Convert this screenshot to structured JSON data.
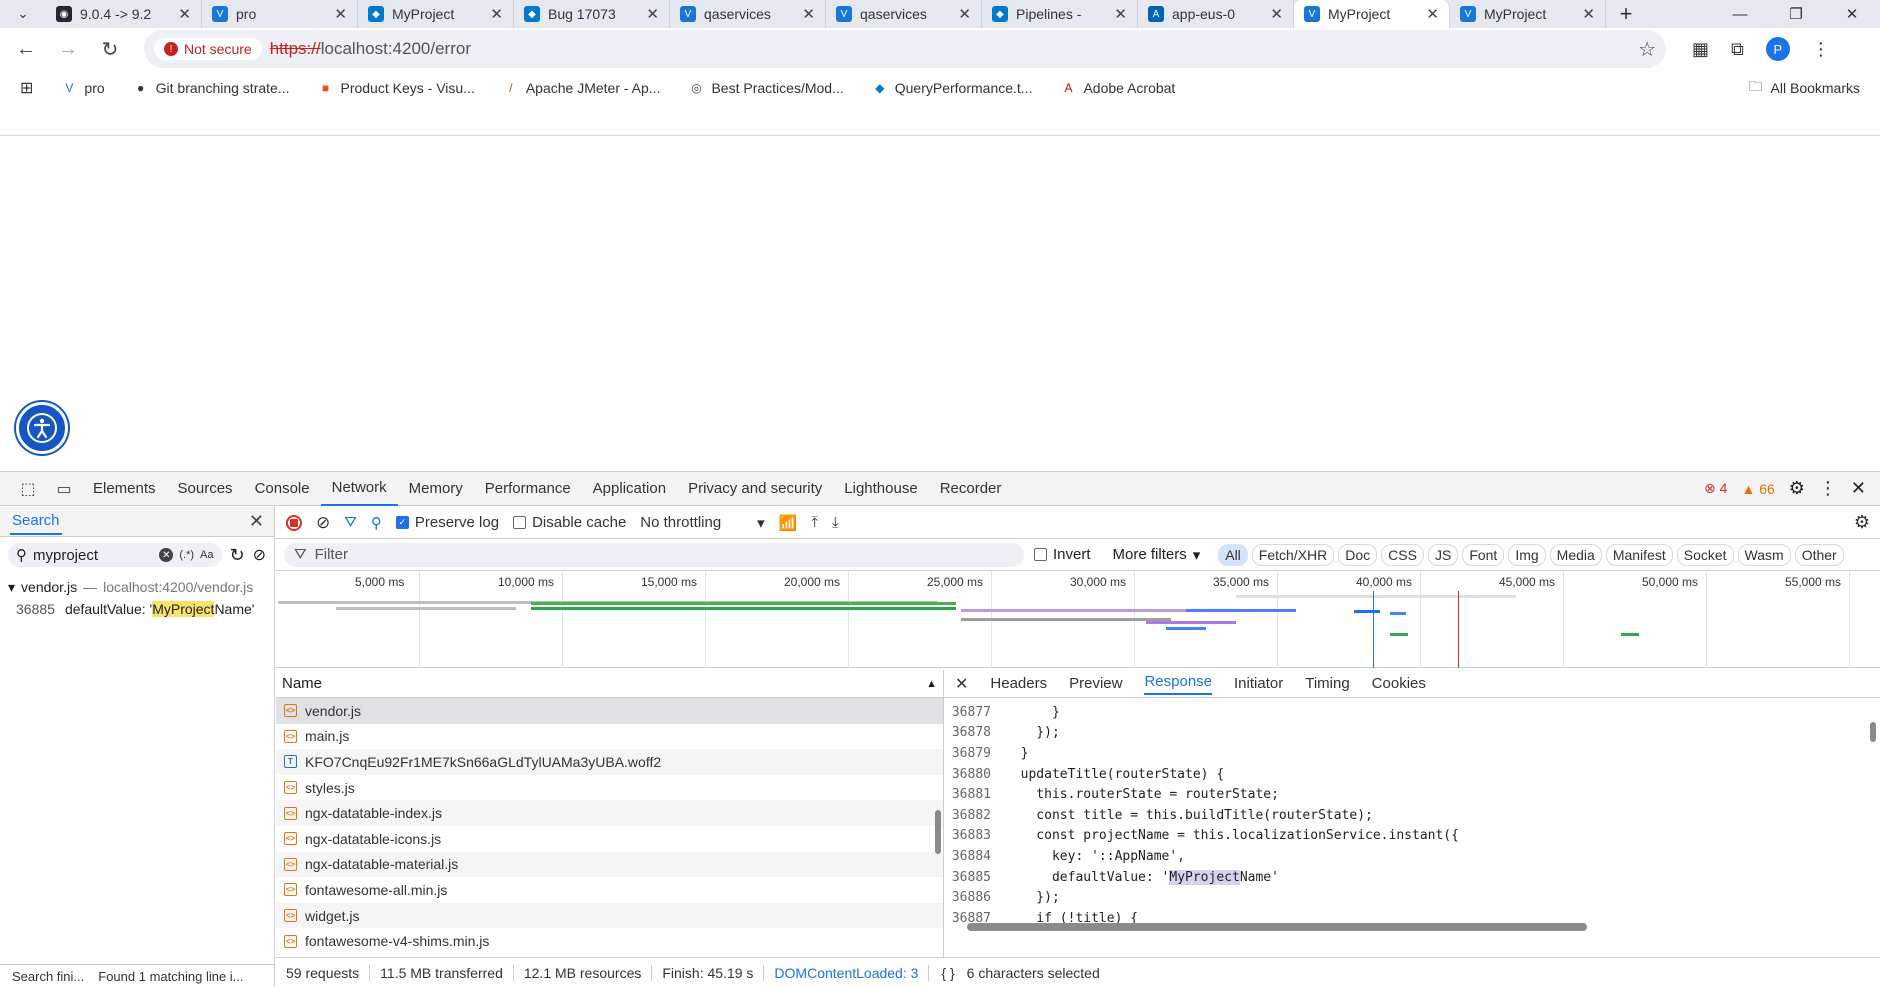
{
  "browser": {
    "tabs": [
      {
        "label": "9.0.4 -> 9.2",
        "icon": "github-icon",
        "active": false
      },
      {
        "label": "pro",
        "icon": "vo-icon",
        "active": false
      },
      {
        "label": "MyProject",
        "icon": "azure-devops-icon",
        "active": false
      },
      {
        "label": "Bug 17073",
        "icon": "azure-devops-icon",
        "active": false
      },
      {
        "label": "qaservices",
        "icon": "vo-icon",
        "active": false
      },
      {
        "label": "qaservices",
        "icon": "vo-icon",
        "active": false
      },
      {
        "label": "Pipelines -",
        "icon": "azure-devops-icon",
        "active": false
      },
      {
        "label": "app-eus-0",
        "icon": "azure-icon",
        "active": false
      },
      {
        "label": "MyProject",
        "icon": "vo-icon",
        "active": true
      },
      {
        "label": "MyProject",
        "icon": "vo-icon",
        "active": false
      }
    ],
    "security_label": "Not secure",
    "url_scheme": "https://",
    "url_rest": "localhost:4200/error",
    "profile_initial": "P",
    "bookmarks": [
      {
        "label": "pro",
        "icon": "vo-icon"
      },
      {
        "label": "Git branching strate...",
        "icon": "globe-icon"
      },
      {
        "label": "Product Keys - Visu...",
        "icon": "microsoft-icon"
      },
      {
        "label": "Apache JMeter - Ap...",
        "icon": "feather-icon"
      },
      {
        "label": "Best Practices/Mod...",
        "icon": "spiral-icon"
      },
      {
        "label": "QueryPerformance.t...",
        "icon": "azure-devops-icon"
      },
      {
        "label": "Adobe Acrobat",
        "icon": "acrobat-icon"
      }
    ],
    "all_bookmarks": "All Bookmarks"
  },
  "devtools": {
    "tabs": [
      "Elements",
      "Sources",
      "Console",
      "Network",
      "Memory",
      "Performance",
      "Application",
      "Privacy and security",
      "Lighthouse",
      "Recorder"
    ],
    "active_tab": "Network",
    "error_count": "4",
    "warning_count": "66",
    "search": {
      "title": "Search",
      "query": "myproject",
      "regex_label": "(.*)",
      "case_label": "Aa",
      "result_file": "vendor.js",
      "result_path": "localhost:4200/vendor.js",
      "result_line_no": "36885",
      "result_before": "defaultValue: '",
      "result_match": "MyProject",
      "result_after": "Name'",
      "status_left": "Search fini...",
      "status_right": "Found 1 matching line i..."
    },
    "network": {
      "preserve_log": "Preserve log",
      "disable_cache": "Disable cache",
      "throttling": "No throttling",
      "filter_placeholder": "Filter",
      "invert": "Invert",
      "more_filters": "More filters",
      "type_filters": [
        "All",
        "Fetch/XHR",
        "Doc",
        "CSS",
        "JS",
        "Font",
        "Img",
        "Media",
        "Manifest",
        "Socket",
        "Wasm",
        "Other"
      ],
      "timeline_ticks": [
        "5,000 ms",
        "10,000 ms",
        "15,000 ms",
        "20,000 ms",
        "25,000 ms",
        "30,000 ms",
        "35,000 ms",
        "40,000 ms",
        "45,000 ms",
        "50,000 ms",
        "55,000 ms"
      ],
      "name_header": "Name",
      "requests": [
        {
          "name": "vendor.js",
          "type": "script"
        },
        {
          "name": "main.js",
          "type": "script"
        },
        {
          "name": "KFO7CnqEu92Fr1ME7kSn66aGLdTylUAMa3yUBA.woff2",
          "type": "font"
        },
        {
          "name": "styles.js",
          "type": "script"
        },
        {
          "name": "ngx-datatable-index.js",
          "type": "script"
        },
        {
          "name": "ngx-datatable-icons.js",
          "type": "script"
        },
        {
          "name": "ngx-datatable-material.js",
          "type": "script"
        },
        {
          "name": "fontawesome-all.min.js",
          "type": "script"
        },
        {
          "name": "widget.js",
          "type": "script"
        },
        {
          "name": "fontawesome-v4-shims.min.js",
          "type": "script"
        }
      ],
      "status": {
        "requests": "59 requests",
        "transferred": "11.5 MB transferred",
        "resources": "12.1 MB resources",
        "finish": "Finish: 45.19 s",
        "dcl": "DOMContentLoaded: 3"
      }
    },
    "detail": {
      "tabs": [
        "Headers",
        "Preview",
        "Response",
        "Initiator",
        "Timing",
        "Cookies"
      ],
      "active_tab": "Response",
      "code_lines": [
        {
          "no": "36877",
          "text": "      }"
        },
        {
          "no": "36878",
          "text": "    });"
        },
        {
          "no": "36879",
          "text": "  }"
        },
        {
          "no": "36880",
          "text": "  updateTitle(routerState) {"
        },
        {
          "no": "36881",
          "text": "    this.routerState = routerState;"
        },
        {
          "no": "36882",
          "text": "    const title = this.buildTitle(routerState);"
        },
        {
          "no": "36883",
          "text": "    const projectName = this.localizationService.instant({"
        },
        {
          "no": "36884",
          "text": "      key: '::AppName',"
        },
        {
          "no": "36885",
          "text": "      defaultValue: 'MyProjectName'"
        },
        {
          "no": "36886",
          "text": "    });"
        },
        {
          "no": "36887",
          "text": "    if (!title) {"
        }
      ],
      "selection_status": "6 characters selected",
      "braces": "{ }"
    }
  }
}
